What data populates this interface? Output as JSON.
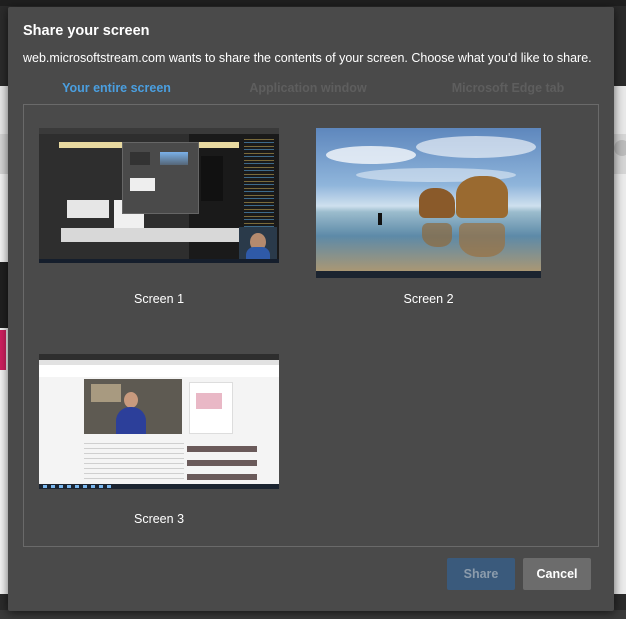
{
  "dialog": {
    "title": "Share your screen",
    "description": "web.microsoftstream.com wants to share the contents of your screen. Choose what you'd like to share."
  },
  "tabs": [
    {
      "label": "Your entire screen",
      "active": true
    },
    {
      "label": "Application window",
      "active": false
    },
    {
      "label": "Microsoft Edge tab",
      "active": false
    }
  ],
  "screens": [
    {
      "label": "Screen 1",
      "thumbnail": "desktop-with-code-editor-and-share-dialog"
    },
    {
      "label": "Screen 2",
      "thumbnail": "windows-beach-rock-wallpaper"
    },
    {
      "label": "Screen 3",
      "thumbnail": "browser-with-video-page"
    }
  ],
  "buttons": {
    "share": "Share",
    "cancel": "Cancel"
  },
  "colors": {
    "accent": "#4a9fe0",
    "dialog_bg": "#4a4a4a",
    "share_disabled_bg": "#3a5a7c",
    "cancel_bg": "#6c6c6c"
  }
}
